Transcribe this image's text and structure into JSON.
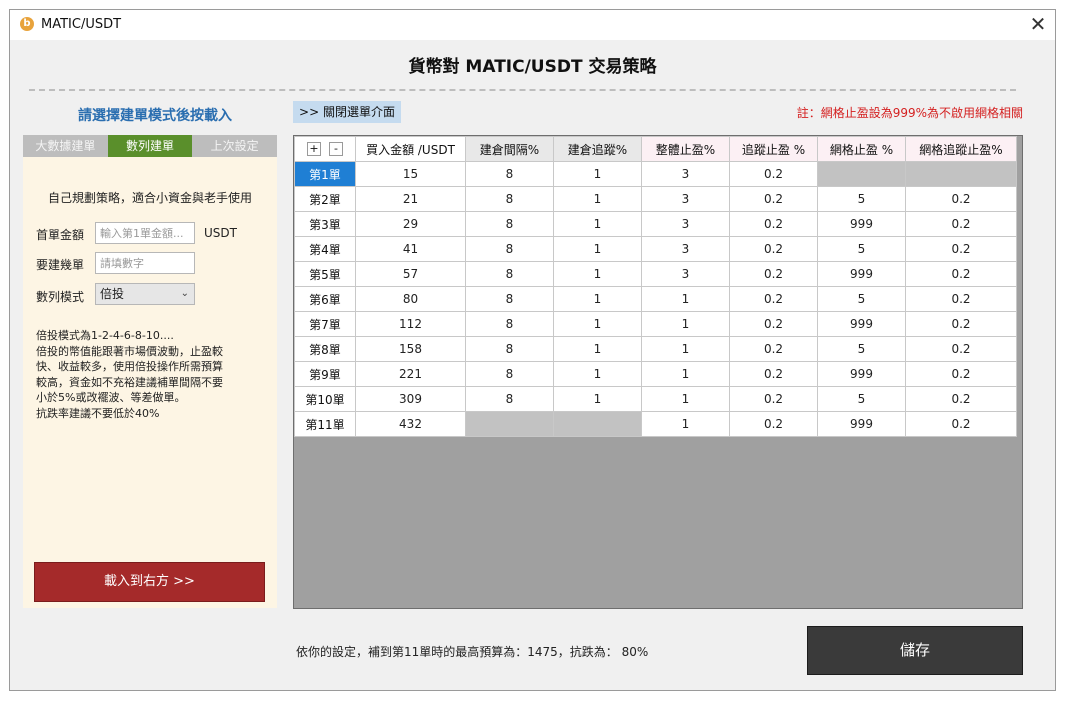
{
  "window": {
    "title": "MATIC/USDT",
    "app_icon": "b",
    "close_glyph": "✕"
  },
  "page_title": "貨幣對 MATIC/USDT  交易策略",
  "left": {
    "heading": "請選擇建單模式後按載入",
    "tabs": [
      {
        "label": "大數據建單",
        "active": false
      },
      {
        "label": "數列建單",
        "active": true
      },
      {
        "label": "上次設定",
        "active": false
      }
    ],
    "description": "自己規劃策略，適合小資金與老手使用",
    "first_amount": {
      "label": "首單金額",
      "placeholder": "輸入第1單金額...",
      "unit": "USDT"
    },
    "order_count": {
      "label": "要建幾單",
      "placeholder": "請填數字"
    },
    "sequence_mode": {
      "label": "數列模式",
      "value": "倍投"
    },
    "note_lines": [
      "倍投模式為1-2-4-6-8-10....",
      "倍投的幣值能跟著市場價波動，止盈較",
      "快、收益較多，使用倍投操作所需預算",
      "較高，資金如不充裕建議補單間隔不要",
      "小於5%或改襬波、等差做單。",
      "抗跌率建議不要低於40%"
    ],
    "load_button": "載入到右方 >>"
  },
  "close_menu_button": ">> 關閉選單介面",
  "note_red": "註：網格止盈設為999%為不啟用網格相關",
  "grid": {
    "add_button": "+",
    "remove_button": "-",
    "columns": [
      "買入金額 /USDT",
      "建倉間隔%",
      "建倉追蹤%",
      "整體止盈%",
      "追蹤止盈 %",
      "網格止盈 %",
      "網格追蹤止盈%"
    ],
    "rows": [
      {
        "label": "第1單",
        "cells": [
          "15",
          "8",
          "1",
          "3",
          "0.2",
          "",
          ""
        ]
      },
      {
        "label": "第2單",
        "cells": [
          "21",
          "8",
          "1",
          "3",
          "0.2",
          "5",
          "0.2"
        ]
      },
      {
        "label": "第3單",
        "cells": [
          "29",
          "8",
          "1",
          "3",
          "0.2",
          "999",
          "0.2"
        ]
      },
      {
        "label": "第4單",
        "cells": [
          "41",
          "8",
          "1",
          "3",
          "0.2",
          "5",
          "0.2"
        ]
      },
      {
        "label": "第5單",
        "cells": [
          "57",
          "8",
          "1",
          "3",
          "0.2",
          "999",
          "0.2"
        ]
      },
      {
        "label": "第6單",
        "cells": [
          "80",
          "8",
          "1",
          "1",
          "0.2",
          "5",
          "0.2"
        ]
      },
      {
        "label": "第7單",
        "cells": [
          "112",
          "8",
          "1",
          "1",
          "0.2",
          "999",
          "0.2"
        ]
      },
      {
        "label": "第8單",
        "cells": [
          "158",
          "8",
          "1",
          "1",
          "0.2",
          "5",
          "0.2"
        ]
      },
      {
        "label": "第9單",
        "cells": [
          "221",
          "8",
          "1",
          "1",
          "0.2",
          "999",
          "0.2"
        ]
      },
      {
        "label": "第10單",
        "cells": [
          "309",
          "8",
          "1",
          "1",
          "0.2",
          "5",
          "0.2"
        ]
      },
      {
        "label": "第11單",
        "cells": [
          "432",
          "",
          "",
          "1",
          "0.2",
          "999",
          "0.2"
        ]
      }
    ],
    "selected_row": 0,
    "colors": {
      "selected_row": "#1f7fd4",
      "empty_cell": "#c2c2c2",
      "grid_background": "#a0a0a0"
    }
  },
  "summary": "依你的設定，補到第11單時的最高預算為：1475，抗跌為： 80%",
  "save_button": "儲存",
  "colors": {
    "accent_blue": "#2a6eb0",
    "tab_active": "#5a8f2b",
    "load_button": "#a52a2a",
    "save_button": "#3a3a3a",
    "note_red": "#d42020"
  }
}
